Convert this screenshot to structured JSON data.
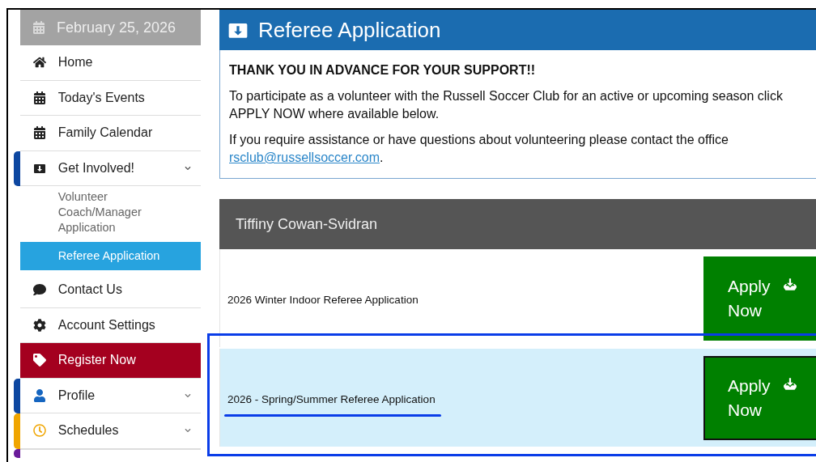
{
  "sidebar": {
    "date": "February 25, 2026",
    "items": [
      {
        "kind": "item",
        "label": "Home",
        "selected": false
      },
      {
        "kind": "item",
        "label": "Today's Events",
        "selected": false
      },
      {
        "kind": "item",
        "label": "Family Calendar",
        "selected": false
      },
      {
        "kind": "group",
        "label": "Get Involved!",
        "expanded": true,
        "color": "#0d47a1",
        "children": [
          {
            "label": "Volunteer Coach/Manager Application",
            "selected": false
          },
          {
            "label": "Referee Application",
            "selected": true
          }
        ]
      },
      {
        "kind": "item",
        "label": "Contact Us",
        "selected": false
      },
      {
        "kind": "item",
        "label": "Account Settings",
        "selected": false
      },
      {
        "kind": "register",
        "label": "Register Now"
      },
      {
        "kind": "group",
        "label": "Profile",
        "expanded": false,
        "color": "#0d47a1"
      },
      {
        "kind": "group",
        "label": "Schedules",
        "expanded": false,
        "color": "#f0a500"
      },
      {
        "kind": "stub",
        "color": "#6a1b9a"
      }
    ]
  },
  "page": {
    "title": "Referee Application",
    "heading": "THANK YOU IN ADVANCE FOR YOUR SUPPORT!!",
    "paragraphs": [
      "To participate as a volunteer with the Russell Soccer Club for an active or upcoming season click APPLY NOW where available below."
    ],
    "contact_text": "If you require assistance or have questions about volunteering please contact the office",
    "contact_email": "rsclub@russellsoccer.com",
    "contact_end": "."
  },
  "member": {
    "name": "Tiffiny Cowan-Svidran",
    "applications": [
      {
        "title": "2026 Winter Indoor Referee Application",
        "button": "Apply Now",
        "selected": false,
        "annotated": false
      },
      {
        "title": "2026 - Spring/Summer Referee Application",
        "button": "Apply Now",
        "selected": true,
        "annotated": true
      }
    ]
  }
}
